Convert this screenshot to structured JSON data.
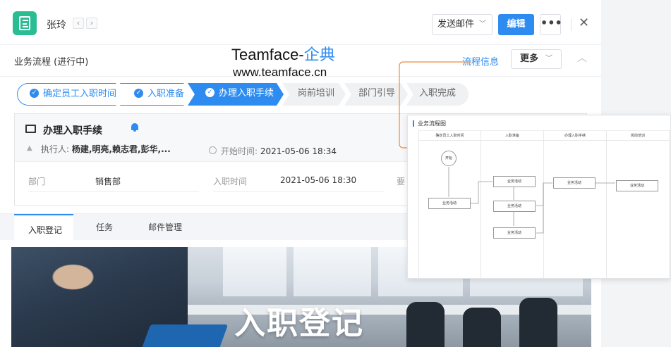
{
  "colors": {
    "accent": "#2e8cf0",
    "app_icon": "#2bbd92",
    "connector": "#f08a3c"
  },
  "header": {
    "user_name": "张玲",
    "prev_icon": "‹",
    "next_icon": "›",
    "send_mail_label": "发送邮件",
    "edit_label": "编辑",
    "more_dots": "•••",
    "close_icon": "✕"
  },
  "process": {
    "title": "业务流程 (进行中)",
    "info_link": "流程信息",
    "more_label": "更多",
    "collapse_icon": "︿"
  },
  "watermark": {
    "brand_prefix": "Teamface-",
    "brand_accent": "企典",
    "url": "www.teamface.cn"
  },
  "steps": [
    {
      "label": "确定员工入职时间",
      "state": "done"
    },
    {
      "label": "入职准备",
      "state": "done"
    },
    {
      "label": "办理入职手续",
      "state": "current"
    },
    {
      "label": "岗前培训",
      "state": "todo"
    },
    {
      "label": "部门引导",
      "state": "todo"
    },
    {
      "label": "入职完成",
      "state": "todo"
    }
  ],
  "task": {
    "title": "办理入职手续",
    "executor_label": "执行人: ",
    "executor_value": "杨建,明亮,赖志君,彭华,...",
    "start_time_label": "开始时间: ",
    "start_time_value": "2021-05-06 18:34",
    "fields": [
      {
        "label": "部门",
        "value": "销售部"
      },
      {
        "label": "入职时间",
        "value": "2021-05-06 18:30"
      },
      {
        "label": "要"
      }
    ]
  },
  "tabs": [
    {
      "label": "入职登记",
      "active": true
    },
    {
      "label": "任务",
      "active": false
    },
    {
      "label": "邮件管理",
      "active": false
    }
  ],
  "banner": {
    "title": "入职登记"
  },
  "flow_diagram": {
    "title": "业务流程图",
    "columns": [
      "确定员工入职时间",
      "入职准备",
      "办理入职手续",
      "岗前培训"
    ],
    "start_label": "开始",
    "node_label": "业务活动"
  }
}
